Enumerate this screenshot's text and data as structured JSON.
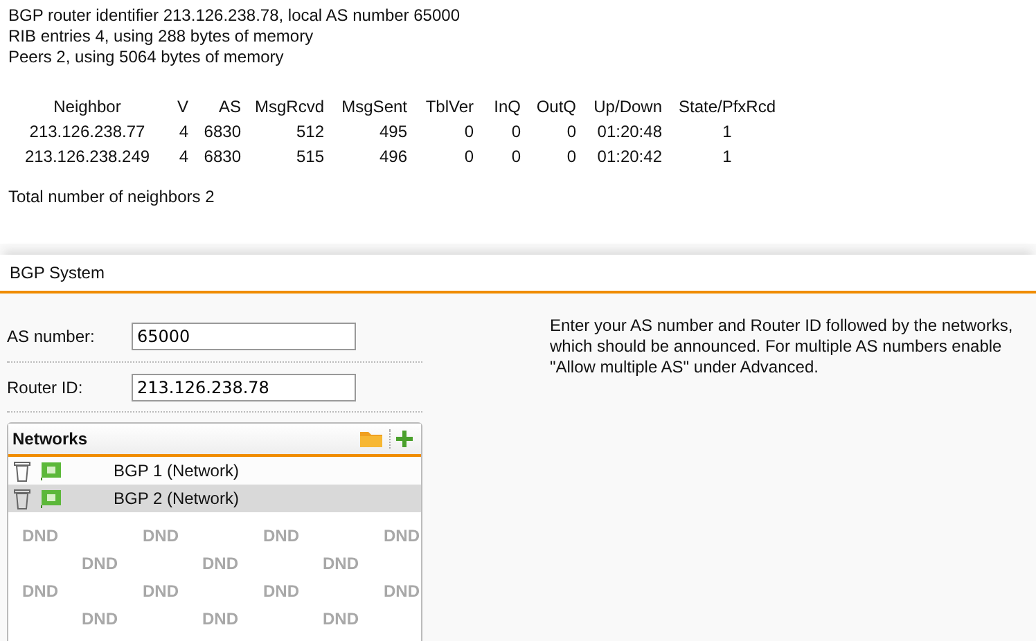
{
  "summary_lines": [
    "BGP router identifier 213.126.238.78, local AS number 65000",
    "RIB entries 4, using 288 bytes of memory",
    "Peers 2, using 5064 bytes of memory"
  ],
  "neighbor_table": {
    "columns": [
      "Neighbor",
      "V",
      "AS",
      "MsgRcvd",
      "MsgSent",
      "TblVer",
      "InQ",
      "OutQ",
      "Up/Down",
      "State/PfxRcd"
    ],
    "rows": [
      [
        "213.126.238.77",
        "4",
        "6830",
        "512",
        "495",
        "0",
        "0",
        "0",
        "01:20:48",
        "1"
      ],
      [
        "213.126.238.249",
        "4",
        "6830",
        "515",
        "496",
        "0",
        "0",
        "0",
        "01:20:42",
        "1"
      ]
    ]
  },
  "total_line": "Total number of neighbors 2",
  "section_title": "BGP System",
  "fields": [
    {
      "label": "AS number:",
      "value": "65000"
    },
    {
      "label": "Router ID:",
      "value": "213.126.238.78"
    }
  ],
  "help_text": "Enter your AS number and Router ID followed by the networks, which should be announced. For multiple AS numbers enable \"Allow multiple AS\" under Advanced.",
  "networks": {
    "title": "Networks",
    "items": [
      {
        "name": "BGP 1 (Network)",
        "selected": false
      },
      {
        "name": "BGP 2 (Network)",
        "selected": true
      }
    ],
    "drop_hints": [
      "DND",
      "DND",
      "DND",
      "DND",
      "DND",
      "DND",
      "DND",
      "DND",
      "DND",
      "DND",
      "DND",
      "DND",
      "DND",
      "DND"
    ]
  }
}
